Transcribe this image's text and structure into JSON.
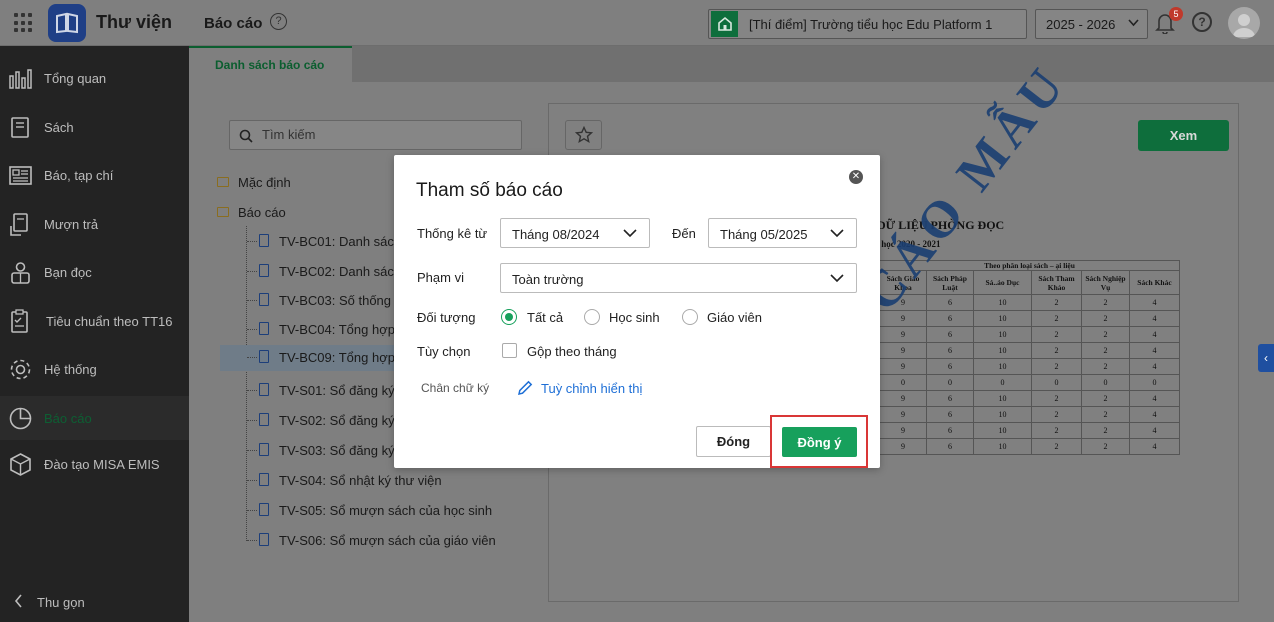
{
  "header": {
    "app_title": "Thư viện",
    "page_title": "Báo cáo",
    "help_icon": "question-circle-icon",
    "school": "[Thí điểm] Trường tiểu học Edu Platform 1",
    "school_year": "2025 - 2026",
    "notification_count": "5"
  },
  "sidebar": {
    "items": [
      {
        "label": "Tổng quan",
        "icon": "bar-chart-icon"
      },
      {
        "label": "Sách",
        "icon": "book-icon"
      },
      {
        "label": "Báo, tạp chí",
        "icon": "newspaper-icon"
      },
      {
        "label": "Mượn trả",
        "icon": "borrow-return-icon"
      },
      {
        "label": "Bạn đọc",
        "icon": "reader-icon"
      },
      {
        "label": "Tiêu chuẩn theo TT16",
        "icon": "standard-document-icon"
      },
      {
        "label": "Hệ thống",
        "icon": "gear-icon"
      },
      {
        "label": "Báo cáo",
        "icon": "pie-chart-icon"
      },
      {
        "label": "Đào tạo MISA EMIS",
        "icon": "cube-icon"
      }
    ],
    "active_index": 7,
    "collapse_label": "Thu gọn"
  },
  "tabs": [
    {
      "label": "Danh sách báo cáo"
    }
  ],
  "search": {
    "placeholder": "Tìm kiếm"
  },
  "tree": {
    "folders": [
      {
        "label": "Mặc định"
      },
      {
        "label": "Báo cáo"
      }
    ],
    "reports": [
      {
        "label": "TV-BC01: Danh sách"
      },
      {
        "label": "TV-BC02: Danh sách"
      },
      {
        "label": "TV-BC03: Số thống"
      },
      {
        "label": "TV-BC04: Tổng hợp"
      },
      {
        "label": "TV-BC09: Tổng hợp s"
      },
      {
        "label": "TV-S01: Sổ đăng ký"
      },
      {
        "label": "TV-S02: Sổ đăng ký"
      },
      {
        "label": "TV-S03: Sổ đăng ký"
      },
      {
        "label": "TV-S04: Sổ nhật ký thư viện"
      },
      {
        "label": "TV-S05: Sổ mượn sách của học sinh"
      },
      {
        "label": "TV-S06: Sổ mượn sách của giáo viên"
      }
    ],
    "selected_index": 4
  },
  "preview": {
    "view_button": "Xem",
    "report_title": "DỮ LIỆU PHÒNG ĐỌC",
    "report_subtitle": "n học 2020 - 2021",
    "group_header": "Theo phân loại sách – ại liệu",
    "columns": [
      "Sách Giáo Khoa",
      "Sách Pháp Luật",
      "Sá..ảo Dục",
      "Sách Tham Khảo",
      "Sách Nghiệp Vụ",
      "Sách Khác"
    ],
    "rows": [
      [
        "9",
        "6",
        "10",
        "2",
        "2",
        "4"
      ],
      [
        "9",
        "6",
        "10",
        "2",
        "2",
        "4"
      ],
      [
        "9",
        "6",
        "10",
        "2",
        "2",
        "4"
      ],
      [
        "9",
        "6",
        "10",
        "2",
        "2",
        "4"
      ],
      [
        "9",
        "6",
        "10",
        "2",
        "2",
        "4"
      ],
      [
        "0",
        "0",
        "0",
        "0",
        "0",
        "0"
      ],
      [
        "9",
        "6",
        "10",
        "2",
        "2",
        "4"
      ],
      [
        "9",
        "6",
        "10",
        "2",
        "2",
        "4"
      ],
      [
        "9",
        "6",
        "10",
        "2",
        "2",
        "4"
      ],
      [
        "9",
        "6",
        "10",
        "2",
        "2",
        "4"
      ]
    ],
    "watermark": "BÁO CÁO MẪU"
  },
  "modal": {
    "title": "Tham số báo cáo",
    "from_label": "Thống kê từ",
    "from_value": "Tháng 08/2024",
    "to_label": "Đến",
    "to_value": "Tháng 05/2025",
    "scope_label": "Phạm vi",
    "scope_value": "Toàn trường",
    "target_label": "Đối tượng",
    "targets": [
      {
        "label": "Tất cả",
        "checked": true
      },
      {
        "label": "Học sinh",
        "checked": false
      },
      {
        "label": "Giáo viên",
        "checked": false
      }
    ],
    "options_label": "Tùy chọn",
    "group_by_month_label": "Gộp theo tháng",
    "group_by_month_checked": false,
    "signature_label": "Chân chữ ký",
    "customize_link": "Tuỳ chỉnh hiển thị",
    "close_button": "Đóng",
    "ok_button": "Đồng ý"
  },
  "colors": {
    "accent_green": "#17a05c",
    "dark_green": "#0e6e3c",
    "link_blue": "#1e6fd6",
    "highlight_red": "#d93636",
    "badge_red": "#c0392b"
  }
}
